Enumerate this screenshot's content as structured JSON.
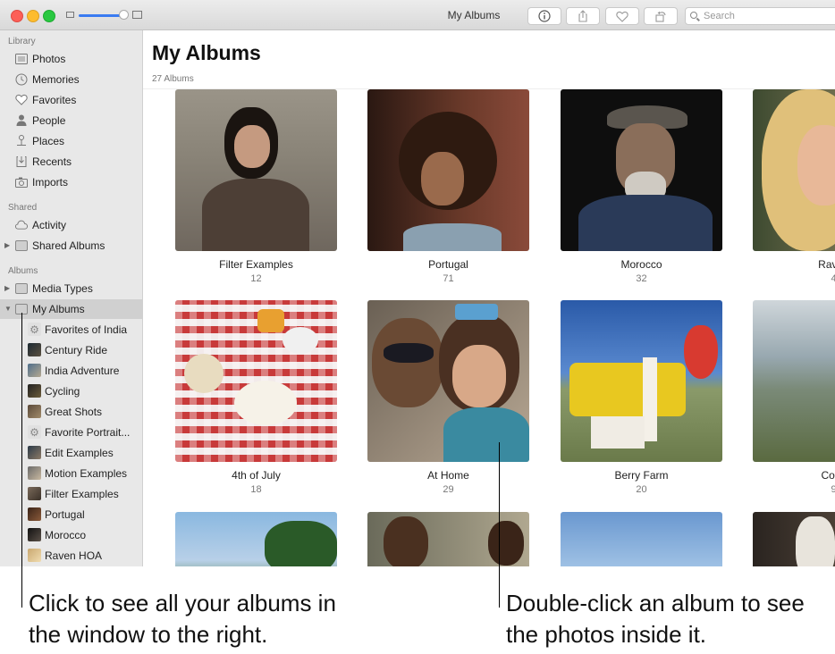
{
  "window": {
    "title": "My Albums",
    "search_placeholder": "Search",
    "toolbar_icons": [
      "info-icon",
      "share-icon",
      "heart-icon",
      "rotate-icon"
    ],
    "zoom_level": 0.85
  },
  "sidebar": {
    "sections": [
      {
        "header": "Library",
        "items": [
          {
            "label": "Photos",
            "icon": "photos-icon"
          },
          {
            "label": "Memories",
            "icon": "memories-icon"
          },
          {
            "label": "Favorites",
            "icon": "heart-icon"
          },
          {
            "label": "People",
            "icon": "person-icon"
          },
          {
            "label": "Places",
            "icon": "pin-icon"
          },
          {
            "label": "Recents",
            "icon": "recents-icon"
          },
          {
            "label": "Imports",
            "icon": "imports-icon"
          }
        ]
      },
      {
        "header": "Shared",
        "items": [
          {
            "label": "Activity",
            "icon": "cloud-icon"
          },
          {
            "label": "Shared Albums",
            "icon": "shared-folder-icon"
          }
        ]
      },
      {
        "header": "Albums",
        "items": [
          {
            "label": "Media Types",
            "icon": "folder-icon"
          },
          {
            "label": "My Albums",
            "icon": "folder-icon"
          }
        ]
      }
    ],
    "my_albums": [
      "Favorites of India",
      "Century Ride",
      "India Adventure",
      "Cycling",
      "Great Shots",
      "Favorite Portrait...",
      "Edit Examples",
      "Motion Examples",
      "Filter Examples",
      "Portugal",
      "Morocco",
      "Raven HOA"
    ]
  },
  "main": {
    "title": "My Albums",
    "count": "27 Albums",
    "albums": [
      {
        "name": "Filter Examples",
        "count": "12"
      },
      {
        "name": "Portugal",
        "count": "71"
      },
      {
        "name": "Morocco",
        "count": "32"
      },
      {
        "name": "Raven",
        "count": "4"
      },
      {
        "name": "4th of July",
        "count": "18"
      },
      {
        "name": "At Home",
        "count": "29"
      },
      {
        "name": "Berry Farm",
        "count": "20"
      },
      {
        "name": "Coas",
        "count": "9"
      }
    ]
  },
  "callouts": {
    "left": "Click to see all your albums in the window to the right.",
    "right": "Double-click an album to see the photos inside it."
  },
  "colors": {
    "accent": "#3a7bf1",
    "sidebar_bg": "#e8e8e8",
    "selection": "#d0d0d0"
  }
}
